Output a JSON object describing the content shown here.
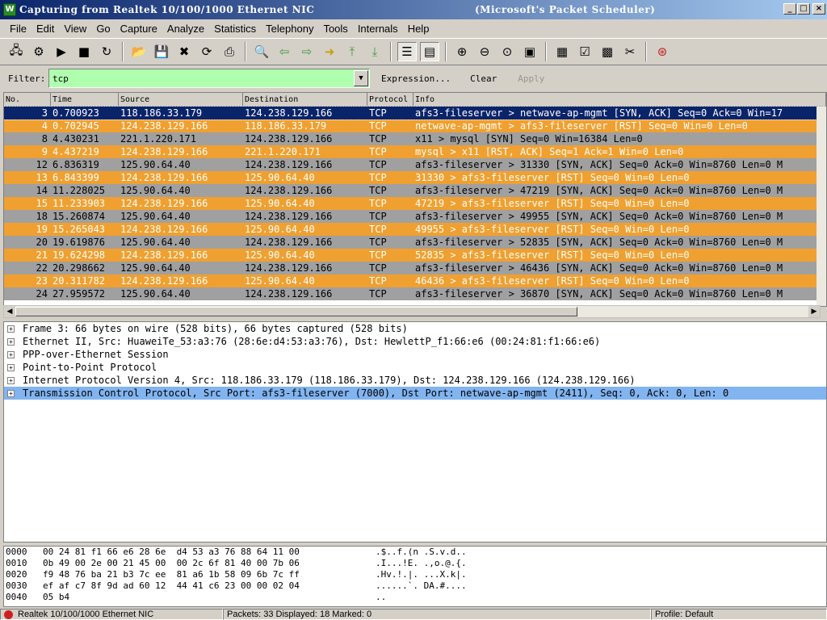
{
  "window": {
    "title": "Capturing from Realtek 10/100/1000 Ethernet NIC",
    "title_suffix": "(Microsoft's Packet Scheduler)"
  },
  "menu": [
    "File",
    "Edit",
    "View",
    "Go",
    "Capture",
    "Analyze",
    "Statistics",
    "Telephony",
    "Tools",
    "Internals",
    "Help"
  ],
  "filter": {
    "label": "Filter:",
    "value": "tcp",
    "expression": "Expression...",
    "clear": "Clear",
    "apply": "Apply"
  },
  "packet_list": {
    "columns": [
      "No.",
      "Time",
      "Source",
      "Destination",
      "Protocol",
      "Info"
    ],
    "rows": [
      {
        "no": "3",
        "time": "0.700923",
        "src": "118.186.33.179",
        "dst": "124.238.129.166",
        "proto": "TCP",
        "info": "afs3-fileserver > netwave-ap-mgmt [SYN, ACK] Seq=0 Ack=0 Win=17",
        "style": "selected"
      },
      {
        "no": "4",
        "time": "0.702945",
        "src": "124.238.129.166",
        "dst": "118.186.33.179",
        "proto": "TCP",
        "info": "netwave-ap-mgmt > afs3-fileserver [RST] Seq=0 Win=0 Len=0",
        "style": "orange"
      },
      {
        "no": "8",
        "time": "4.430231",
        "src": "221.1.220.171",
        "dst": "124.238.129.166",
        "proto": "TCP",
        "info": "x11 > mysql [SYN] Seq=0 Win=16384 Len=0",
        "style": "gray"
      },
      {
        "no": "9",
        "time": "4.437219",
        "src": "124.238.129.166",
        "dst": "221.1.220.171",
        "proto": "TCP",
        "info": "mysql > x11 [RST, ACK] Seq=1 Ack=1 Win=0 Len=0",
        "style": "orange"
      },
      {
        "no": "12",
        "time": "6.836319",
        "src": "125.90.64.40",
        "dst": "124.238.129.166",
        "proto": "TCP",
        "info": "afs3-fileserver > 31330 [SYN, ACK] Seq=0 Ack=0 Win=8760 Len=0 M",
        "style": "gray"
      },
      {
        "no": "13",
        "time": "6.843399",
        "src": "124.238.129.166",
        "dst": "125.90.64.40",
        "proto": "TCP",
        "info": "31330 > afs3-fileserver [RST] Seq=0 Win=0 Len=0",
        "style": "orange"
      },
      {
        "no": "14",
        "time": "11.228025",
        "src": "125.90.64.40",
        "dst": "124.238.129.166",
        "proto": "TCP",
        "info": "afs3-fileserver > 47219 [SYN, ACK] Seq=0 Ack=0 Win=8760 Len=0 M",
        "style": "gray"
      },
      {
        "no": "15",
        "time": "11.233903",
        "src": "124.238.129.166",
        "dst": "125.90.64.40",
        "proto": "TCP",
        "info": "47219 > afs3-fileserver [RST] Seq=0 Win=0 Len=0",
        "style": "orange"
      },
      {
        "no": "18",
        "time": "15.260874",
        "src": "125.90.64.40",
        "dst": "124.238.129.166",
        "proto": "TCP",
        "info": "afs3-fileserver > 49955 [SYN, ACK] Seq=0 Ack=0 Win=8760 Len=0 M",
        "style": "gray"
      },
      {
        "no": "19",
        "time": "15.265043",
        "src": "124.238.129.166",
        "dst": "125.90.64.40",
        "proto": "TCP",
        "info": "49955 > afs3-fileserver [RST] Seq=0 Win=0 Len=0",
        "style": "orange"
      },
      {
        "no": "20",
        "time": "19.619876",
        "src": "125.90.64.40",
        "dst": "124.238.129.166",
        "proto": "TCP",
        "info": "afs3-fileserver > 52835 [SYN, ACK] Seq=0 Ack=0 Win=8760 Len=0 M",
        "style": "gray"
      },
      {
        "no": "21",
        "time": "19.624298",
        "src": "124.238.129.166",
        "dst": "125.90.64.40",
        "proto": "TCP",
        "info": "52835 > afs3-fileserver [RST] Seq=0 Win=0 Len=0",
        "style": "orange"
      },
      {
        "no": "22",
        "time": "20.298662",
        "src": "125.90.64.40",
        "dst": "124.238.129.166",
        "proto": "TCP",
        "info": "afs3-fileserver > 46436 [SYN, ACK] Seq=0 Ack=0 Win=8760 Len=0 M",
        "style": "gray"
      },
      {
        "no": "23",
        "time": "20.311782",
        "src": "124.238.129.166",
        "dst": "125.90.64.40",
        "proto": "TCP",
        "info": "46436 > afs3-fileserver [RST] Seq=0 Win=0 Len=0",
        "style": "orange"
      },
      {
        "no": "24",
        "time": "27.959572",
        "src": "125.90.64.40",
        "dst": "124.238.129.166",
        "proto": "TCP",
        "info": "afs3-fileserver > 36870 [SYN, ACK] Seq=0 Ack=0 Win=8760 Len=0 M",
        "style": "gray"
      }
    ]
  },
  "details": [
    {
      "text": "Frame 3: 66 bytes on wire (528 bits), 66 bytes captured (528 bits)"
    },
    {
      "text": "Ethernet II, Src: HuaweiTe_53:a3:76 (28:6e:d4:53:a3:76), Dst: HewlettP_f1:66:e6 (00:24:81:f1:66:e6)"
    },
    {
      "text": "PPP-over-Ethernet Session"
    },
    {
      "text": "Point-to-Point Protocol"
    },
    {
      "text": "Internet Protocol Version 4, Src: 118.186.33.179 (118.186.33.179), Dst: 124.238.129.166 (124.238.129.166)"
    },
    {
      "text": "Transmission Control Protocol, Src Port: afs3-fileserver (7000), Dst Port: netwave-ap-mgmt (2411), Seq: 0, Ack: 0, Len: 0",
      "selected": true
    }
  ],
  "hex": [
    {
      "off": "0000",
      "bytes": "00 24 81 f1 66 e6 28 6e  d4 53 a3 76 88 64 11 00",
      "ascii": ".$..f.(n .S.v.d.."
    },
    {
      "off": "0010",
      "bytes": "0b 49 00 2e 00 21 45 00  00 2c 6f 81 40 00 7b 06",
      "ascii": ".I...!E. .,o.@.{."
    },
    {
      "off": "0020",
      "bytes": "f9 48 76 ba 21 b3 7c ee  81 a6 1b 58 09 6b 7c ff",
      "ascii": ".Hv.!.|. ...X.k|."
    },
    {
      "off": "0030",
      "bytes": "ef af c7 8f 9d ad 60 12  44 41 c6 23 00 00 02 04",
      "ascii": "......`. DA.#...."
    },
    {
      "off": "0040",
      "bytes": "05 b4",
      "ascii": ".."
    }
  ],
  "status": {
    "interface": "Realtek 10/100/1000 Ethernet NIC",
    "packets": "Packets: 33 Displayed: 18 Marked: 0",
    "profile": "Profile: Default"
  }
}
